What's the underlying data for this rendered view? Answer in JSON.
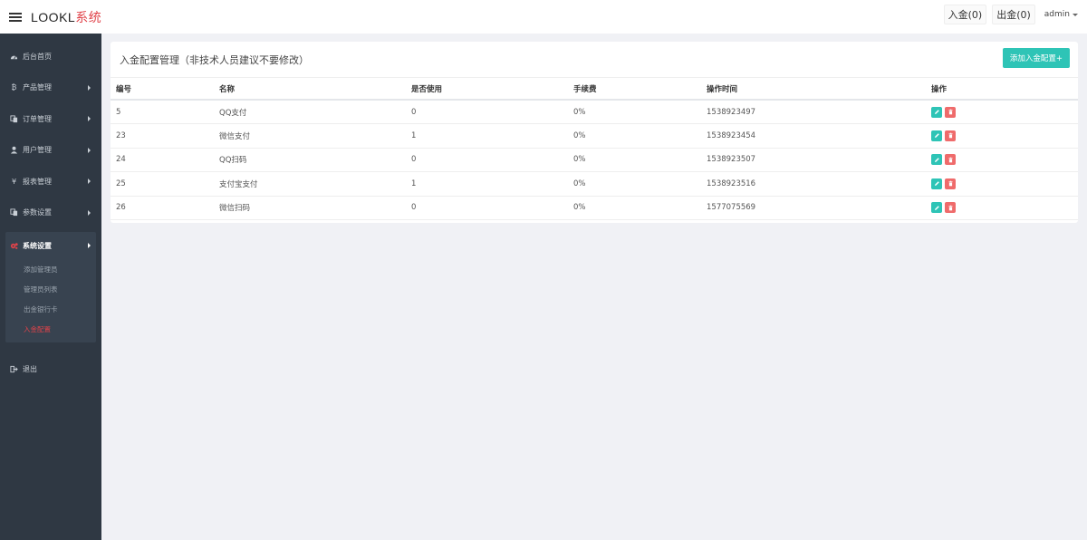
{
  "header": {
    "brand_main": "LOOKL",
    "brand_sub": "系统",
    "deposit_label": "入金(0)",
    "withdraw_label": "出金(0)",
    "user_label": "admin"
  },
  "sidebar": {
    "items": [
      {
        "label": "后台首页",
        "icon": "dashboard-icon"
      },
      {
        "label": "产品管理",
        "icon": "bitcoin-icon"
      },
      {
        "label": "订单管理",
        "icon": "copy-icon"
      },
      {
        "label": "用户管理",
        "icon": "user-icon"
      },
      {
        "label": "报表管理",
        "icon": "yen-icon"
      },
      {
        "label": "参数设置",
        "icon": "copy-icon"
      }
    ],
    "group": {
      "label": "系统设置",
      "icon": "cogs-icon",
      "sub_items": [
        "添加管理员",
        "管理员列表",
        "出金银行卡",
        "入金配置"
      ]
    },
    "logout_label": "退出"
  },
  "panel": {
    "title": "入金配置管理（非技术人员建议不要修改）",
    "add_button": "添加入金配置+",
    "columns": [
      "编号",
      "名称",
      "是否使用",
      "手续费",
      "操作时间",
      "操作"
    ],
    "rows": [
      {
        "id": "5",
        "name": "QQ支付",
        "used": "0",
        "fee": "0%",
        "time": "1538923497"
      },
      {
        "id": "23",
        "name": "微信支付",
        "used": "1",
        "fee": "0%",
        "time": "1538923454"
      },
      {
        "id": "24",
        "name": "QQ扫码",
        "used": "0",
        "fee": "0%",
        "time": "1538923507"
      },
      {
        "id": "25",
        "name": "支付宝支付",
        "used": "1",
        "fee": "0%",
        "time": "1538923516"
      },
      {
        "id": "26",
        "name": "微信扫码",
        "used": "0",
        "fee": "0%",
        "time": "1577075569"
      }
    ]
  },
  "colors": {
    "accent": "#e0434a",
    "teal": "#2ec4b6",
    "danger": "#ef6b6b",
    "sidebar_bg": "#2f3843"
  }
}
